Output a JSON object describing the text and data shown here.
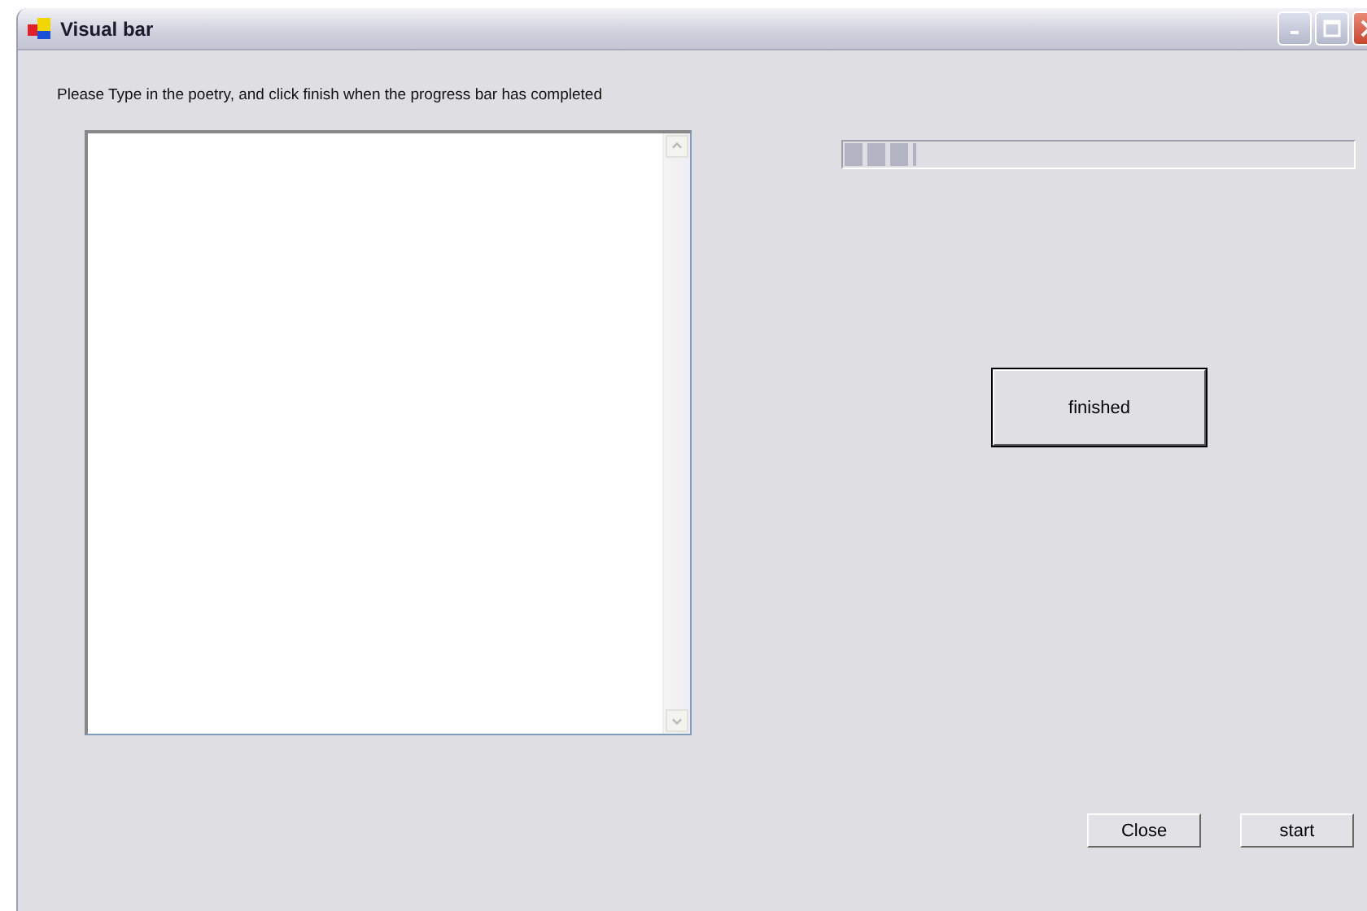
{
  "window": {
    "title": "Visual bar"
  },
  "instruction": "Please Type in the poetry, and click finish when the progress bar has completed",
  "progress": {
    "level": 0.14
  },
  "finish_button": {
    "label": "finished",
    "default": true
  },
  "buttons": [
    {
      "label": "Close"
    },
    {
      "label": "start"
    }
  ]
}
